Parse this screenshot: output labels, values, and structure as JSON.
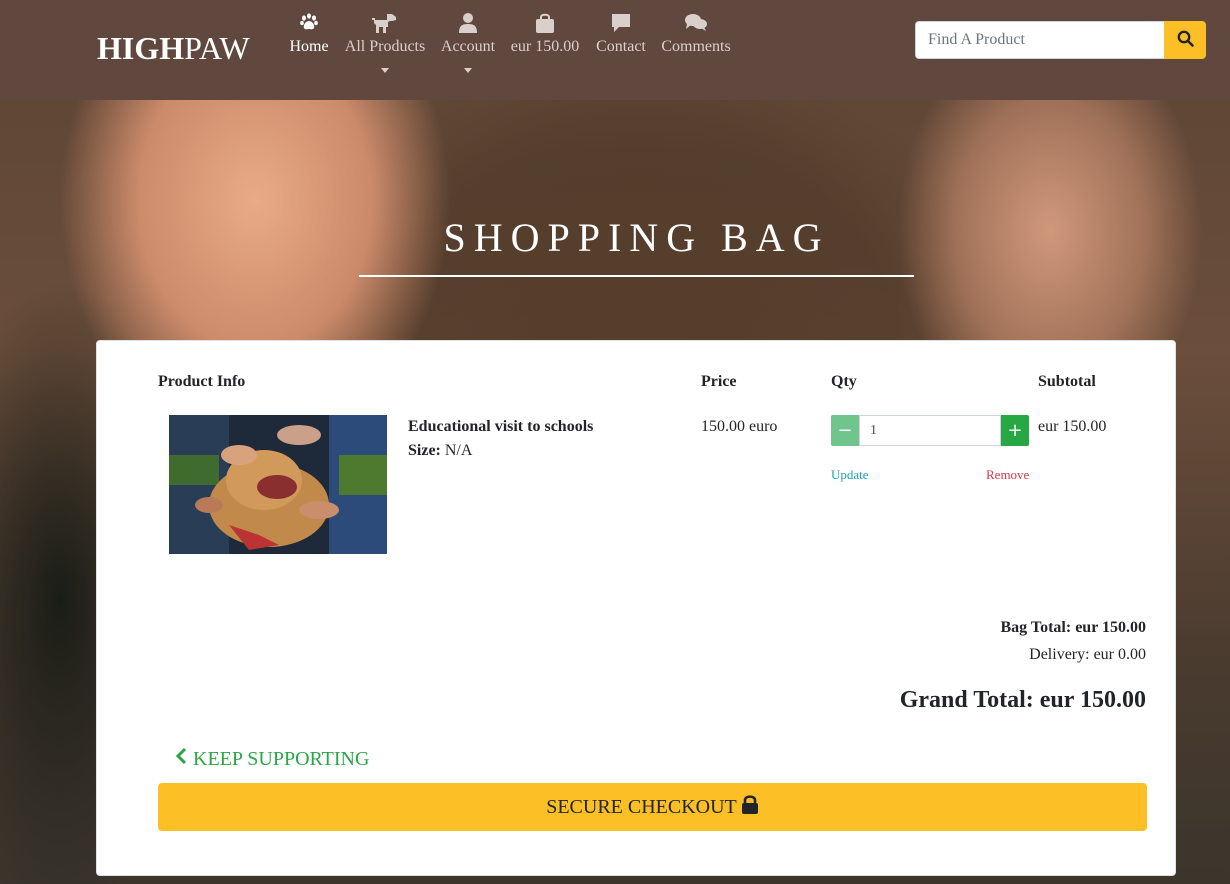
{
  "brand": {
    "bold": "HIGH",
    "light": "PAW"
  },
  "nav": [
    {
      "label": "Home",
      "icon": "paw-icon",
      "active": true
    },
    {
      "label": "All Products",
      "icon": "dog-icon",
      "dropdown": true
    },
    {
      "label": "Account",
      "icon": "user-icon",
      "dropdown": true
    },
    {
      "label": "eur 150.00",
      "icon": "shopping-bag-icon"
    },
    {
      "label": "Contact",
      "icon": "comment-icon"
    },
    {
      "label": "Comments",
      "icon": "comments-icon"
    }
  ],
  "search": {
    "placeholder": "Find A Product",
    "value": ""
  },
  "hero": {
    "title": "SHOPPING BAG"
  },
  "table": {
    "headers": {
      "product": "Product Info",
      "price": "Price",
      "qty": "Qty",
      "subtotal": "Subtotal"
    },
    "items": [
      {
        "name": "Educational visit to schools",
        "size_label": "Size:",
        "size_value": "N/A",
        "price": "150.00 euro",
        "qty": "1",
        "update": "Update",
        "remove": "Remove",
        "subtotal": "eur 150.00"
      }
    ]
  },
  "totals": {
    "bag_total": "Bag Total: eur 150.00",
    "delivery": "Delivery: eur 0.00",
    "grand_total": "Grand Total: eur 150.00"
  },
  "actions": {
    "keep_supporting": "Keep Supporting",
    "secure_checkout": "Secure Checkout"
  },
  "colors": {
    "navbar": "#60483f",
    "accent_yellow": "#fcbf25",
    "success_green": "#28a745",
    "info_link": "#17a2b8",
    "danger_link": "#dc3545"
  }
}
